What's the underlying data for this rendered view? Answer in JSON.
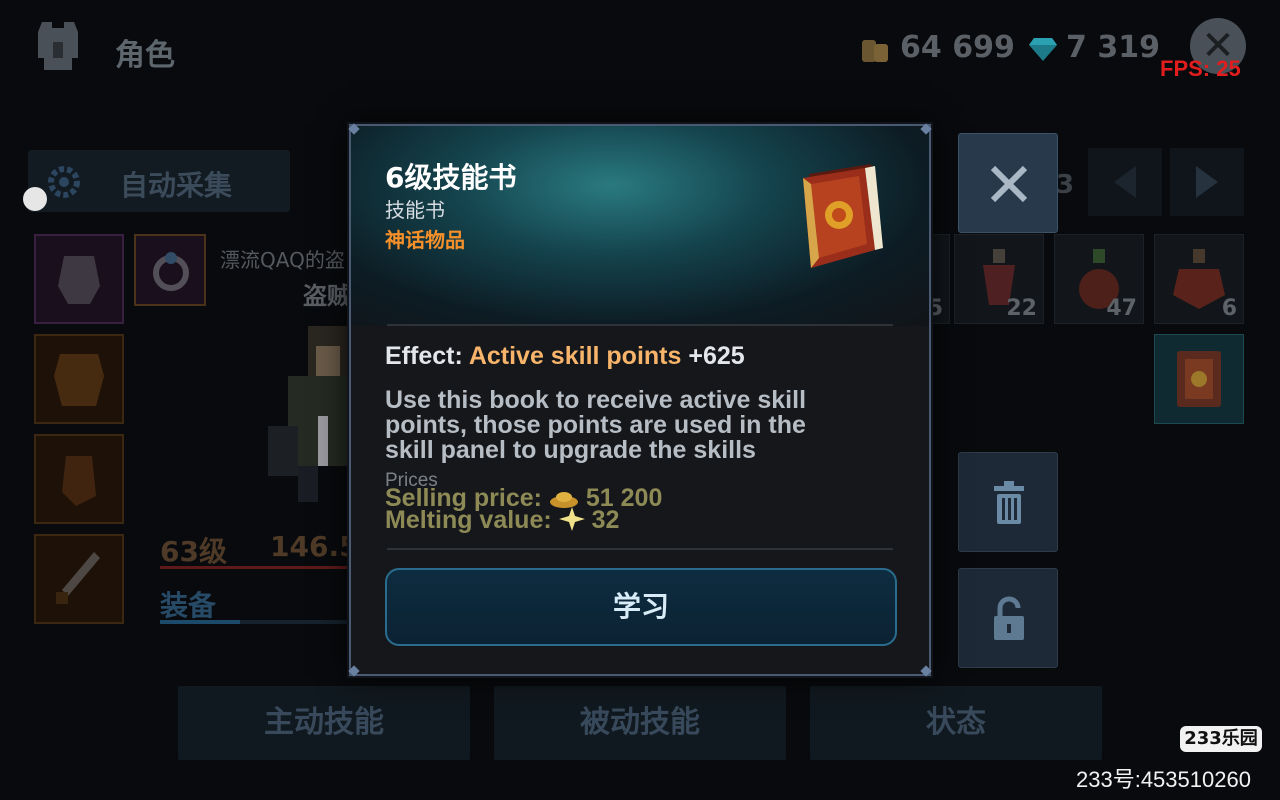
{
  "header": {
    "title": "角色",
    "gold": "64 699",
    "gems": "7 319",
    "fps": "FPS: 25"
  },
  "left": {
    "auto_collect": "自动采集",
    "player_name": "漂流QAQ的盗",
    "player_class": "盗贼",
    "level": "63级",
    "power": "146.5",
    "equip_tab": "装备"
  },
  "inventory": {
    "page_num": "3",
    "counts": [
      "5",
      "22",
      "47",
      "6"
    ]
  },
  "bottom_tabs": [
    "主动技能",
    "被动技能",
    "状态"
  ],
  "modal": {
    "title": "6级技能书",
    "type": "技能书",
    "rarity": "神话物品",
    "effect_label": "Effect:",
    "effect_name": "Active skill points",
    "effect_value": "+625",
    "description_lines": [
      "Use this book to receive active skill",
      "points, those points are used in the",
      "skill panel to upgrade the skills"
    ],
    "prices_label": "Prices",
    "selling_label": "Selling price:",
    "selling_value": "51 200",
    "melting_label": "Melting value:",
    "melting_value": "32",
    "learn_button": "学习"
  },
  "watermark": {
    "logo": "233乐园",
    "id": "233号:453510260"
  },
  "colors": {
    "rarity_mythic": "#f5902a",
    "effect_highlight": "#f7b46a",
    "fps_red": "#e21d1d",
    "button_border": "#2a6c8e"
  }
}
